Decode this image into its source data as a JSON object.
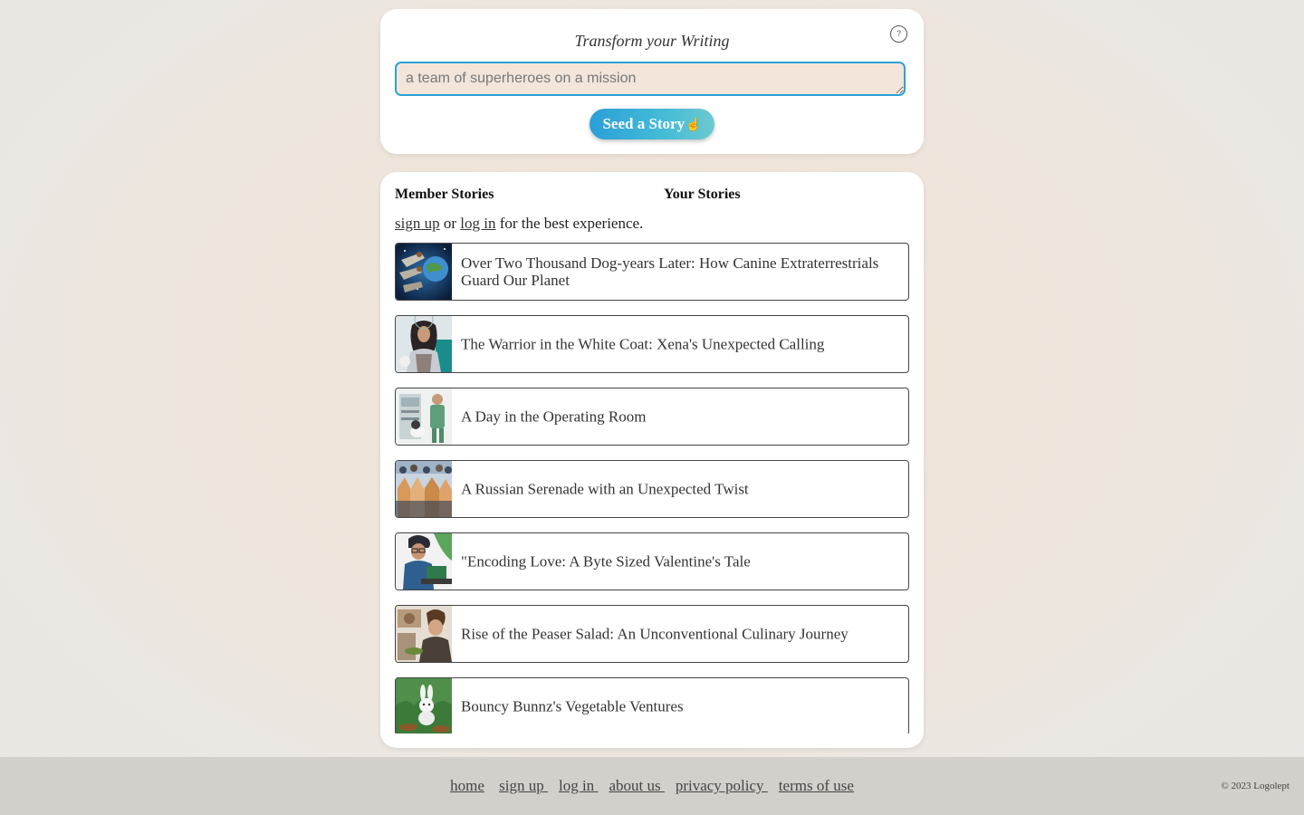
{
  "seed": {
    "title": "Transform your Writing",
    "help_label": "?",
    "input_placeholder": "a team of superheroes on a mission",
    "input_value": "",
    "button_label": "Seed a Story",
    "button_icon": "☝"
  },
  "stories": {
    "tabs": [
      {
        "label": "Member Stories"
      },
      {
        "label": "Your Stories"
      }
    ],
    "auth": {
      "signup": "sign up",
      "or": " or ",
      "login": "log in",
      "suffix": " for the best experience."
    },
    "items": [
      {
        "title": "Over Two Thousand Dog-years Later: How Canine Extraterrestrials Guard Our Planet",
        "thumb": "planet-dogs"
      },
      {
        "title": "The Warrior in the White Coat: Xena's Unexpected Calling",
        "thumb": "warrior-woman"
      },
      {
        "title": "A Day in the Operating Room",
        "thumb": "surgeon-dog"
      },
      {
        "title": "A Russian Serenade with an Unexpected Twist",
        "thumb": "crowd-dogs"
      },
      {
        "title": "\"Encoding Love: A Byte Sized Valentine's Tale",
        "thumb": "coder-man"
      },
      {
        "title": "Rise of the Peaser Salad: An Unconventional Culinary Journey",
        "thumb": "chef-man"
      },
      {
        "title": "Bouncy Bunnz's Vegetable Ventures",
        "thumb": "bunny-garden"
      }
    ]
  },
  "footer": {
    "links": [
      "home",
      "sign up ",
      "log in ",
      "about us ",
      "privacy policy ",
      "terms of use"
    ],
    "copyright": "© 2023 Logolept"
  }
}
